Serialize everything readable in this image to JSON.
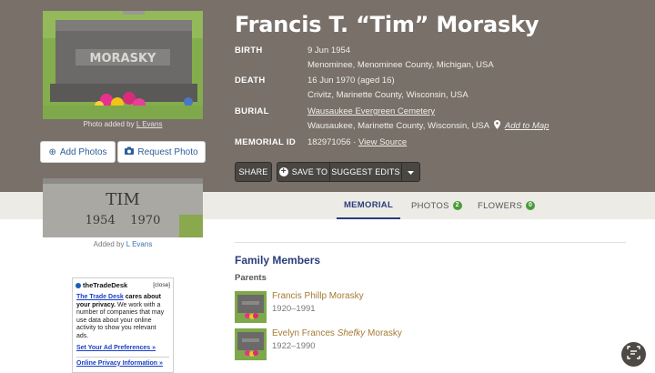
{
  "memorial": {
    "name": "Francis T. “Tim” Morasky",
    "photo_caption_prefix": "Photo added by ",
    "photo_caption_user": "L Evans"
  },
  "facts": {
    "birth_label": "BIRTH",
    "birth_date": "9 Jun 1954",
    "birth_place": "Menominee, Menominee County, Michigan, USA",
    "death_label": "DEATH",
    "death_date": "16 Jun 1970 (aged 16)",
    "death_place": "Crivitz, Marinette County, Wisconsin, USA",
    "burial_label": "BURIAL",
    "burial_cemetery": "Wausaukee Evergreen Cemetery",
    "burial_place": "Wausaukee, Marinette County, Wisconsin, USA",
    "add_to_map": "Add to Map",
    "memorial_id_label": "MEMORIAL ID",
    "memorial_id": "182971056",
    "separator": " · ",
    "view_source": "View Source"
  },
  "buttons": {
    "add_photos": "Add Photos",
    "request_photo": "Request Photo",
    "share": "SHARE",
    "save_to": "SAVE TO",
    "suggest_edits": "SUGGEST EDITS"
  },
  "tim_photo": {
    "caption_prefix": "Added by ",
    "caption_user": "L Evans",
    "stone_name": "TIM",
    "stone_years": "1954    1970"
  },
  "headstone_text": "MORASKY",
  "tabs": [
    {
      "label": "MEMORIAL",
      "active": true
    },
    {
      "label": "PHOTOS",
      "count": "2"
    },
    {
      "label": "FLOWERS",
      "count": "0"
    }
  ],
  "family": {
    "title": "Family Members",
    "parents_label": "Parents",
    "members": [
      {
        "first": "Francis Phillp Morasky",
        "years": "1920–1991"
      },
      {
        "first": "Evelyn Frances ",
        "maiden": "Shefky",
        "last": " Morasky",
        "years": "1922–1990"
      }
    ]
  },
  "ad": {
    "brand": "theTradeDesk",
    "close": "[close]",
    "brand_link": "The Trade Desk",
    "line1": " cares about your privacy.",
    "line2": " We work with a number of companies that may use data about your online activity to show you relevant ads.",
    "set_prefs": "Set Your Ad Preferences »",
    "privacy": "Online Privacy Information »"
  },
  "colors": {
    "hero_bg": "#787069",
    "accent": "#2b3d7a",
    "link_gold": "#a67a35",
    "count_green": "#4a9b3a"
  }
}
